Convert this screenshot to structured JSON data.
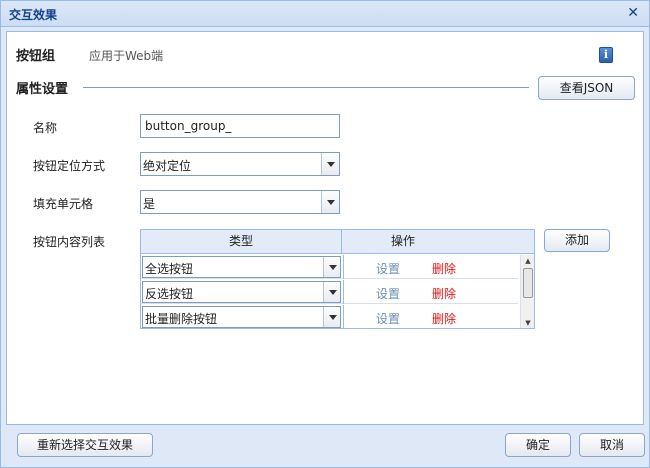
{
  "window": {
    "title": "交互效果"
  },
  "header": {
    "name": "按钮组",
    "subtitle": "应用于Web端"
  },
  "section": {
    "title": "属性设置",
    "view_json_label": "查看JSON"
  },
  "form": {
    "name_label": "名称",
    "name_value": "button_group_",
    "position_label": "按钮定位方式",
    "position_value": "绝对定位",
    "fill_label": "填充单元格",
    "fill_value": "是",
    "list_label": "按钮内容列表",
    "add_label": "添加"
  },
  "grid": {
    "columns": [
      "类型",
      "操作"
    ],
    "rows": [
      {
        "type": "全选按钮",
        "set": "设置",
        "delete": "删除"
      },
      {
        "type": "反选按钮",
        "set": "设置",
        "delete": "删除"
      },
      {
        "type": "批量删除按钮",
        "set": "设置",
        "delete": "删除"
      }
    ]
  },
  "footer": {
    "reselect_label": "重新选择交互效果",
    "ok_label": "确定",
    "cancel_label": "取消"
  },
  "icons": {
    "close": "close-icon",
    "info": "info-icon",
    "dropdown": "chevron-down-icon"
  },
  "colors": {
    "delete": "#e01818",
    "set": "#6d8fb3",
    "title": "#15428b"
  }
}
